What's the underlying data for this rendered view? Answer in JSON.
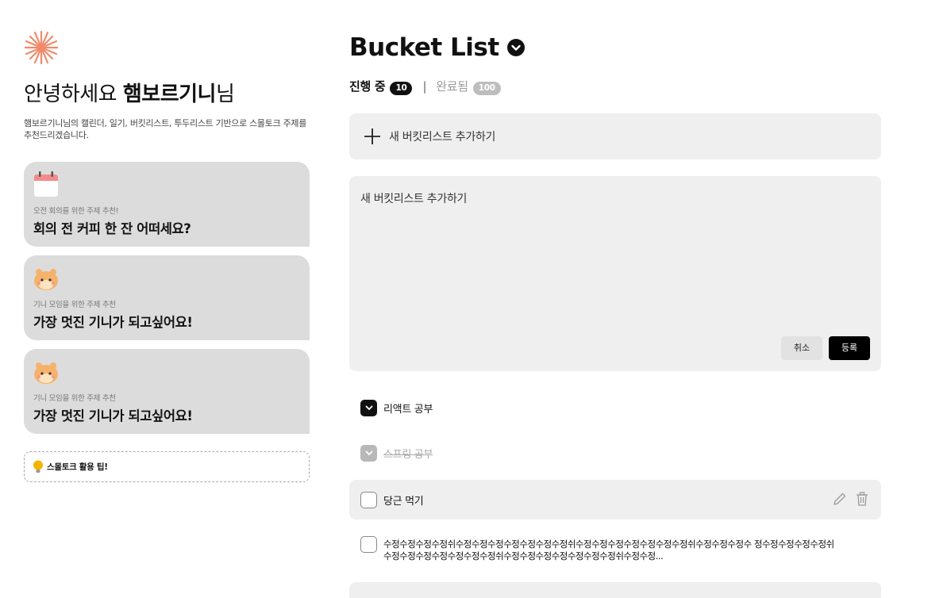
{
  "sidebar": {
    "greeting_prefix": "안녕하세요 ",
    "user_name": "햄보르기니",
    "greeting_suffix": "님",
    "subtitle": "햄보르기니님의 캘린더, 일기, 버킷리스트, 투두리스트 기반으로 스몰토크 주제를 추천드리겠습니다.",
    "cards": [
      {
        "icon": "calendar-icon",
        "caption": "오전 회의를 위한 주제 추천!",
        "title": "회의 전 커피 한 잔 어떠세요?"
      },
      {
        "icon": "hamster-icon",
        "caption": "기니 모임을 위한 주제 추천",
        "title": "가장 멋진 기니가 되고싶어요!"
      },
      {
        "icon": "hamster-icon",
        "caption": "기니 모임을 위한 주제 추천",
        "title": "가장 멋진 기니가 되고싶어요!"
      }
    ],
    "tip": {
      "icon": "lightbulb-icon",
      "label": "스몰토크 활용 팁!"
    }
  },
  "main": {
    "title": "Bucket List",
    "tabs": [
      {
        "label": "진행 중",
        "count": "10",
        "active": true
      },
      {
        "label": "완료됨",
        "count": "100",
        "active": false
      }
    ],
    "tab_separator": "|",
    "add_bar_label": "새 버킷리스트 추가하기",
    "editor": {
      "placeholder": "새 버킷리스트 추가하기",
      "cancel_label": "취소",
      "submit_label": "등록"
    },
    "items": [
      {
        "label": "리액트 공부",
        "state": "checked"
      },
      {
        "label": "스프링 공부",
        "state": "checked-muted"
      },
      {
        "label": "당근 먹기",
        "state": "unchecked"
      },
      {
        "label": "수정수정수정수정쉬수정수정수정수정수정수정수정쉬수정수정수정수정수정수정수정쉬수정수정수정수 정수정수정수정수정쉬수정수정수정수정수정수정수정쉬수정수정수정수정수정수정수정쉬수정수정...",
        "state": "unchecked"
      }
    ]
  },
  "colors": {
    "accent": "#000000",
    "card_bg": "#dcdcdc",
    "panel_bg": "#efefef",
    "logo": "#f08a6a"
  }
}
